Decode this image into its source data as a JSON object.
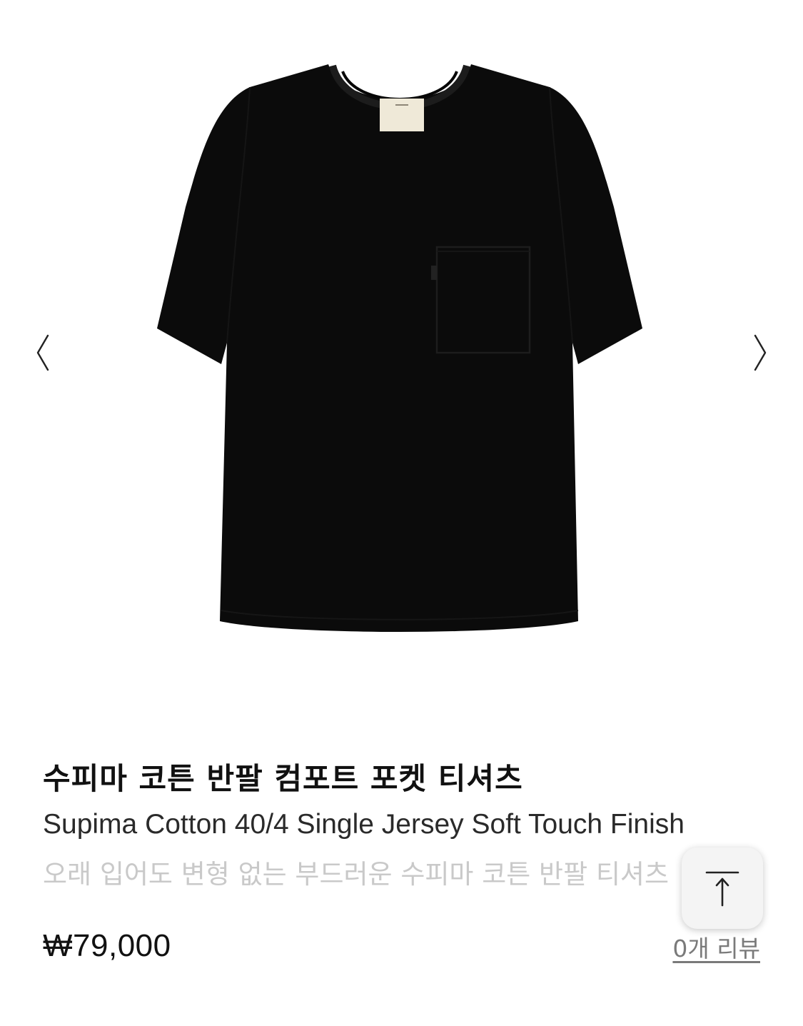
{
  "product": {
    "image_alt": "black short sleeve pocket t-shirt",
    "title_ko": "수피마 코튼 반팔 컴포트 포켓 티셔츠",
    "title_en": "Supima Cotton 40/4 Single Jersey Soft Touch Finish",
    "description": "오래 입어도 변형 없는 부드러운 수피마 코튼 반팔 티셔츠",
    "price": "₩79,000",
    "reviews_link": "0개 리뷰"
  },
  "gallery": {
    "prev_icon": "chevron-left-icon",
    "next_icon": "chevron-right-icon"
  },
  "scroll_top": {
    "icon": "arrow-up-to-top-icon"
  },
  "colors": {
    "shirt": "#0b0b0b",
    "label": "#efe9d8",
    "description_text": "#c9c9c9",
    "review_link": "#7a7a7a",
    "scroll_button_bg": "#f4f4f4"
  }
}
